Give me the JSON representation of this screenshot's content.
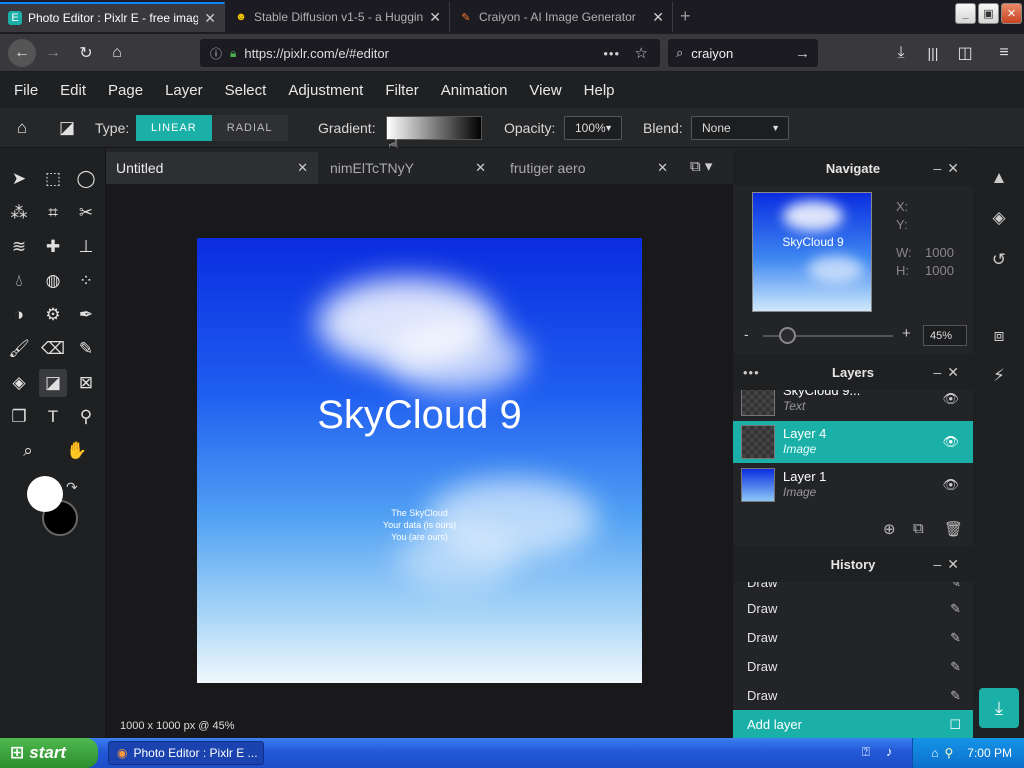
{
  "browser": {
    "tabs": [
      {
        "title": "Photo Editor : Pixlr E - free image",
        "icon": "pixlr-icon"
      },
      {
        "title": "Stable Diffusion v1-5 - a Huggin",
        "icon": "hugging-face-icon"
      },
      {
        "title": "Craiyon - AI Image Generator",
        "icon": "craiyon-icon"
      }
    ],
    "url": "https://pixlr.com/e/#editor",
    "search_value": "craiyon"
  },
  "menu": [
    "File",
    "Edit",
    "Page",
    "Layer",
    "Select",
    "Adjustment",
    "Filter",
    "Animation",
    "View",
    "Help"
  ],
  "options": {
    "type_label": "Type:",
    "type_linear": "LINEAR",
    "type_radial": "RADIAL",
    "gradient_label": "Gradient:",
    "opacity_label": "Opacity:",
    "opacity_value": "100%",
    "blend_label": "Blend:",
    "blend_value": "None"
  },
  "doc_tabs": [
    "Untitled",
    "nimElTcTNyY",
    "frutiger aero"
  ],
  "canvas": {
    "title": "SkyCloud 9",
    "lines": [
      "The SkyCloud",
      "Your data (is ours)",
      "You (are ours)"
    ],
    "status": "1000 x 1000 px @ 45%"
  },
  "navigate": {
    "title": "Navigate",
    "thumb_text": "SkyCloud 9",
    "x_label": "X:",
    "y_label": "Y:",
    "w_label": "W:",
    "w_value": "1000",
    "h_label": "H:",
    "h_value": "1000",
    "zoom_value": "45%"
  },
  "layers": {
    "title": "Layers",
    "items": [
      {
        "name": "SkyCloud 9...",
        "type": "Text"
      },
      {
        "name": "Layer 4",
        "type": "Image",
        "selected": true
      },
      {
        "name": "Layer 1",
        "type": "Image"
      }
    ]
  },
  "history": {
    "title": "History",
    "items": [
      "Draw",
      "Draw",
      "Draw",
      "Draw",
      "Draw",
      "Add layer"
    ]
  },
  "colors": {
    "accent": "#1ab0a8",
    "primary_swatch": "#ffffff",
    "secondary_swatch": "#000000"
  },
  "taskbar": {
    "start_label": "start",
    "task_label": "Photo Editor : Pixlr E ...",
    "clock": "7:00 PM"
  }
}
